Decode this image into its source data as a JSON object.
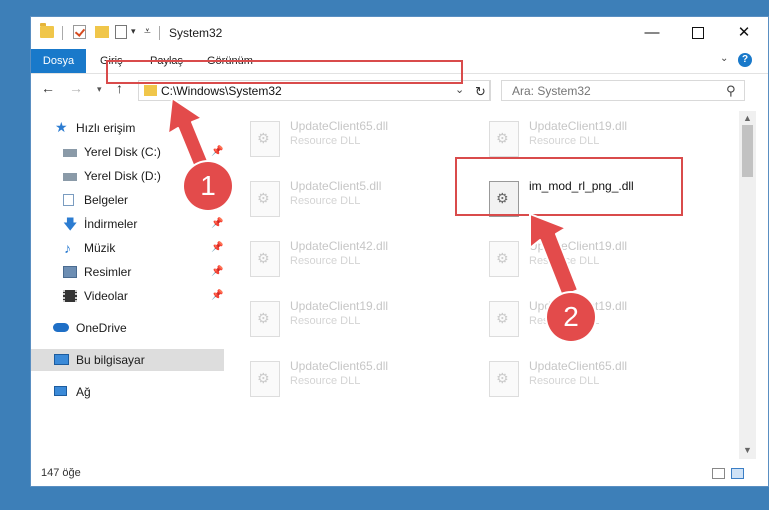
{
  "window": {
    "title": "System32",
    "minimize": "—",
    "close": "✕"
  },
  "ribbon": {
    "tabs": [
      "Dosya",
      "Giriş",
      "Paylaş",
      "Görünüm"
    ],
    "help": "?"
  },
  "address": {
    "path": "C:\\Windows\\System32",
    "search_placeholder": "Ara: System32"
  },
  "sidebar": {
    "items": [
      {
        "label": "Hızlı erişim",
        "icon": "star-icon"
      },
      {
        "label": "Yerel Disk (C:)",
        "icon": "drive-icon",
        "pinned": true
      },
      {
        "label": "Yerel Disk (D:)",
        "icon": "drive-icon"
      },
      {
        "label": "Belgeler",
        "icon": "documents-icon",
        "pinned": true
      },
      {
        "label": "İndirmeler",
        "icon": "download-icon",
        "pinned": true
      },
      {
        "label": "Müzik",
        "icon": "music-icon",
        "pinned": true
      },
      {
        "label": "Resimler",
        "icon": "pictures-icon",
        "pinned": true
      },
      {
        "label": "Videolar",
        "icon": "video-icon",
        "pinned": true
      },
      {
        "label": "OneDrive",
        "icon": "cloud-icon"
      },
      {
        "label": "Bu bilgisayar",
        "icon": "computer-icon",
        "selected": true
      },
      {
        "label": "Ağ",
        "icon": "network-icon"
      }
    ]
  },
  "files": [
    {
      "name": "UpdateClient65.dll",
      "type": "Resource DLL"
    },
    {
      "name": "UpdateClient19.dll",
      "type": "Resource DLL"
    },
    {
      "name": "UpdateClient5.dll",
      "type": "Resource DLL"
    },
    {
      "name": "im_mod_rl_png_.dll",
      "type": "",
      "highlighted": true
    },
    {
      "name": "UpdateClient42.dll",
      "type": "Resource DLL"
    },
    {
      "name": "UpdateClient19.dll",
      "type": "Resource DLL"
    },
    {
      "name": "UpdateClient19.dll",
      "type": "Resource DLL"
    },
    {
      "name": "UpdateClient19.dll",
      "type": "Resource DLL"
    },
    {
      "name": "UpdateClient65.dll",
      "type": "Resource DLL"
    },
    {
      "name": "UpdateClient65.dll",
      "type": "Resource DLL"
    }
  ],
  "status": {
    "item_count": "147 öğe"
  },
  "annotations": {
    "step1": "1",
    "step2": "2",
    "color": "#e34b4b"
  }
}
